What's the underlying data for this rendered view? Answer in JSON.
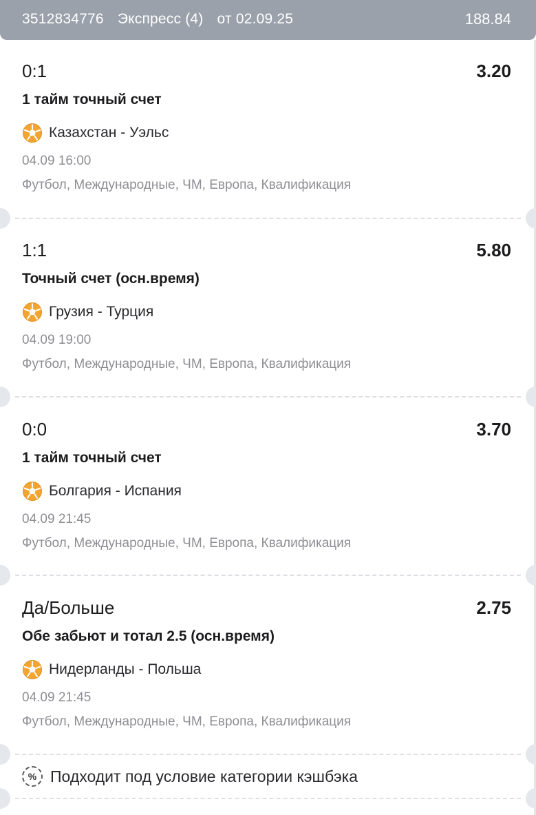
{
  "header": {
    "bet_id": "3512834776",
    "bet_type": "Экспресс (4)",
    "date": "от 02.09.25",
    "total": "188.84"
  },
  "bets": [
    {
      "outcome": "0:1",
      "odds": "3.20",
      "market": "1 тайм точный счет",
      "teams": "Казахстан - Уэльс",
      "time": "04.09 16:00",
      "league": "Футбол, Международные, ЧМ, Европа, Квалификация"
    },
    {
      "outcome": "1:1",
      "odds": "5.80",
      "market": "Точный счет (осн.время)",
      "teams": "Грузия - Турция",
      "time": "04.09 19:00",
      "league": "Футбол, Международные, ЧМ, Европа, Квалификация"
    },
    {
      "outcome": "0:0",
      "odds": "3.70",
      "market": "1 тайм точный счет",
      "teams": "Болгария - Испания",
      "time": "04.09 21:45",
      "league": "Футбол, Международные, ЧМ, Европа, Квалификация"
    },
    {
      "outcome": "Да/Больше",
      "odds": "2.75",
      "market": "Обе забьют и тотал 2.5 (осн.время)",
      "teams": "Нидерланды - Польша",
      "time": "04.09 21:45",
      "league": "Футбол, Международные, ЧМ, Европа, Квалификация"
    }
  ],
  "cashback": {
    "icon": "percent-icon",
    "symbol": "%",
    "text": "Подходит под условие категории кэшбэка"
  },
  "icons": {
    "sport": "soccer-ball-icon"
  },
  "colors": {
    "header_bg": "#9aa1aa",
    "ball": "#f2a531",
    "muted_text": "#8e8e93"
  }
}
